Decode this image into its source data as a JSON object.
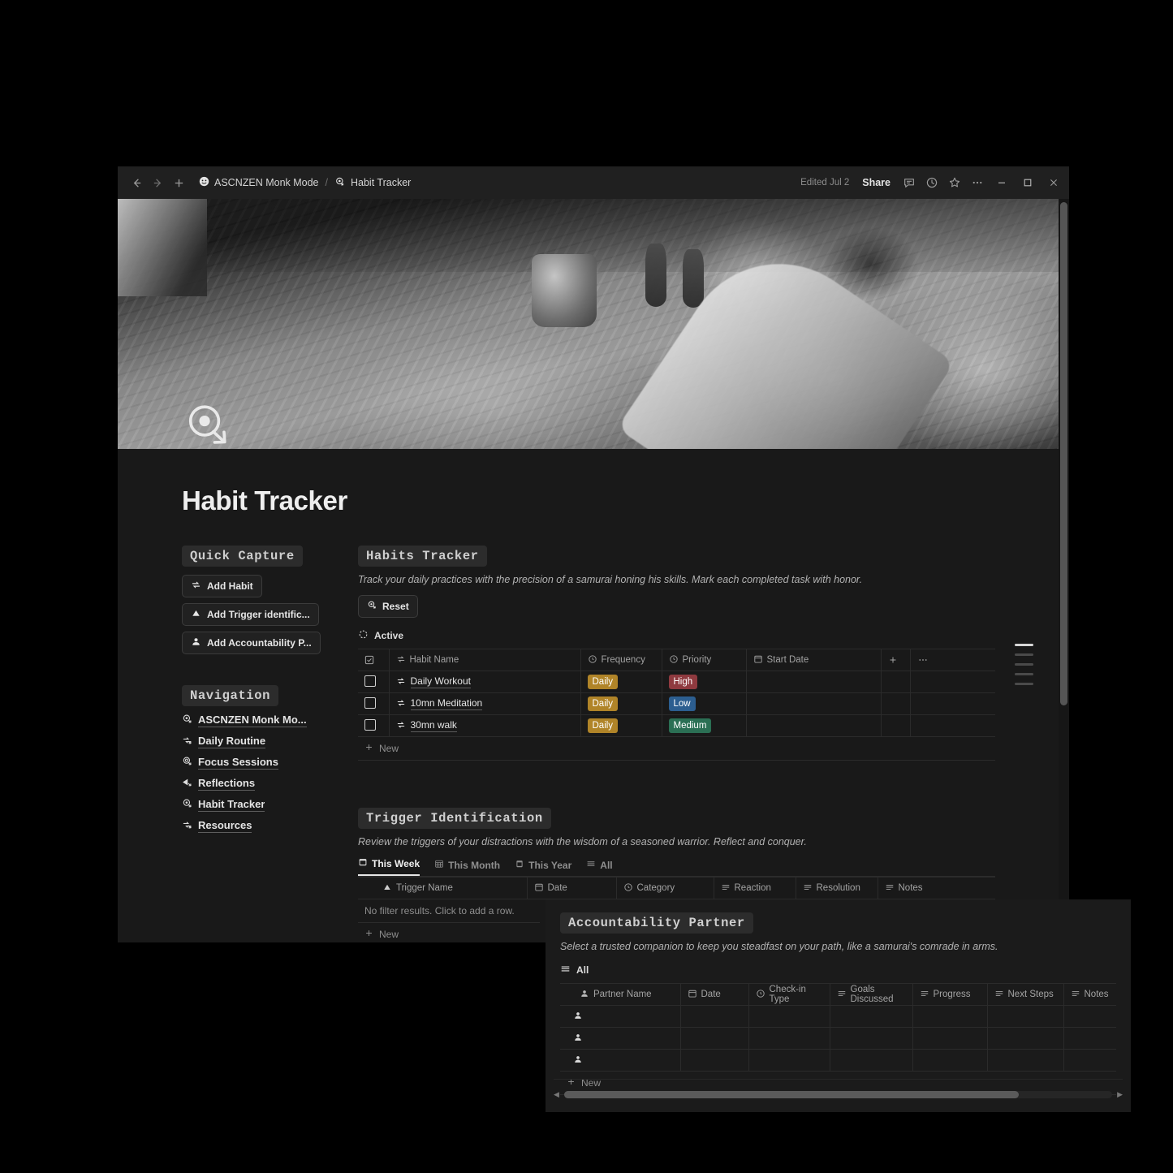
{
  "titlebar": {
    "back_icon": "arrow-left-icon",
    "forward_icon": "arrow-right-icon",
    "new_icon": "plus-icon",
    "workspace": "ASCNZEN Monk Mode",
    "separator": "/",
    "page": "Habit Tracker",
    "edited": "Edited Jul 2",
    "share": "Share",
    "comment_icon": "comment-icon",
    "history_icon": "clock-icon",
    "favorite_icon": "star-icon",
    "more_icon": "ellipsis-icon",
    "minimize_icon": "minimize-icon",
    "maximize_icon": "maximize-icon",
    "close_icon": "close-icon"
  },
  "page": {
    "title": "Habit Tracker",
    "icon": "circular-arrow-icon"
  },
  "quick_capture": {
    "heading": "Quick Capture",
    "buttons": [
      {
        "label": "Add Habit",
        "icon": "repeat-icon"
      },
      {
        "label": "Add Trigger identific...",
        "icon": "triangle-icon"
      },
      {
        "label": "Add Accountability P...",
        "icon": "person-icon"
      }
    ]
  },
  "navigation": {
    "heading": "Navigation",
    "items": [
      {
        "label": "ASCNZEN Monk Mo...",
        "icon": "page-link-icon"
      },
      {
        "label": "Daily Routine",
        "icon": "page-link-icon"
      },
      {
        "label": "Focus Sessions",
        "icon": "page-link-icon"
      },
      {
        "label": "Reflections",
        "icon": "page-link-icon"
      },
      {
        "label": "Habit Tracker",
        "icon": "page-link-icon"
      },
      {
        "label": "Resources",
        "icon": "page-link-icon"
      }
    ]
  },
  "habits": {
    "heading": "Habits Tracker",
    "description": "Track your daily practices with the precision of a samurai honing his skills. Mark each completed task with honor.",
    "reset_label": "Reset",
    "reset_icon": "circular-arrow-icon",
    "view_label": "Active",
    "view_icon": "dashed-circle-icon",
    "columns": [
      {
        "label": "",
        "icon": "checkbox-icon"
      },
      {
        "label": "Habit Name",
        "icon": "repeat-icon"
      },
      {
        "label": "Frequency",
        "icon": "select-icon"
      },
      {
        "label": "Priority",
        "icon": "select-icon"
      },
      {
        "label": "Start Date",
        "icon": "date-icon"
      },
      {
        "label": "",
        "icon": "plus-icon"
      },
      {
        "label": "",
        "icon": "ellipsis-icon"
      }
    ],
    "rows": [
      {
        "checked": false,
        "name": "Daily Workout",
        "frequency": "Daily",
        "priority": "High",
        "start_date": ""
      },
      {
        "checked": false,
        "name": "10mn Meditation",
        "frequency": "Daily",
        "priority": "Low",
        "start_date": ""
      },
      {
        "checked": false,
        "name": "30mn walk",
        "frequency": "Daily",
        "priority": "Medium",
        "start_date": ""
      }
    ],
    "new_label": "New",
    "colors": {
      "frequency_daily": "#b08428",
      "priority_high": "#8f3a3f",
      "priority_low": "#2c5e90",
      "priority_medium": "#2b6f54"
    }
  },
  "triggers": {
    "heading": "Trigger Identification",
    "description": "Review the triggers of your distractions with the wisdom of a seasoned warrior. Reflect and conquer.",
    "tabs": [
      {
        "label": "This Week",
        "icon": "calendar-icon",
        "active": true
      },
      {
        "label": "This Month",
        "icon": "calendar-grid-icon",
        "active": false
      },
      {
        "label": "This Year",
        "icon": "calendar-year-icon",
        "active": false
      },
      {
        "label": "All",
        "icon": "list-icon",
        "active": false
      }
    ],
    "columns": [
      {
        "label": "Trigger Name",
        "icon": "triangle-icon"
      },
      {
        "label": "Date",
        "icon": "date-icon"
      },
      {
        "label": "Category",
        "icon": "select-icon"
      },
      {
        "label": "Reaction",
        "icon": "text-icon"
      },
      {
        "label": "Resolution",
        "icon": "text-icon"
      },
      {
        "label": "Notes",
        "icon": "text-icon"
      }
    ],
    "empty_text": "No filter results. Click to add a row.",
    "new_label": "New"
  },
  "accountability": {
    "heading": "Accountability Partner",
    "description": "Select a trusted companion to keep you steadfast on your path, like a samurai's comrade in arms.",
    "view_label": "All",
    "view_icon": "list-icon",
    "columns": [
      {
        "label": "Partner Name",
        "icon": "person-icon"
      },
      {
        "label": "Date",
        "icon": "date-icon"
      },
      {
        "label": "Check-in Type",
        "icon": "select-icon"
      },
      {
        "label": "Goals Discussed",
        "icon": "text-icon"
      },
      {
        "label": "Progress",
        "icon": "text-icon"
      },
      {
        "label": "Next Steps",
        "icon": "text-icon"
      },
      {
        "label": "Notes",
        "icon": "text-icon"
      }
    ],
    "rows": [
      {
        "name": "",
        "date": "",
        "checkin": "",
        "goals": "",
        "progress": "",
        "next": "",
        "notes": ""
      },
      {
        "name": "",
        "date": "",
        "checkin": "",
        "goals": "",
        "progress": "",
        "next": "",
        "notes": ""
      },
      {
        "name": "",
        "date": "",
        "checkin": "",
        "goals": "",
        "progress": "",
        "next": "",
        "notes": ""
      }
    ],
    "new_label": "New",
    "scroll_left_icon": "chevron-left-icon",
    "scroll_right_icon": "chevron-right-icon"
  }
}
